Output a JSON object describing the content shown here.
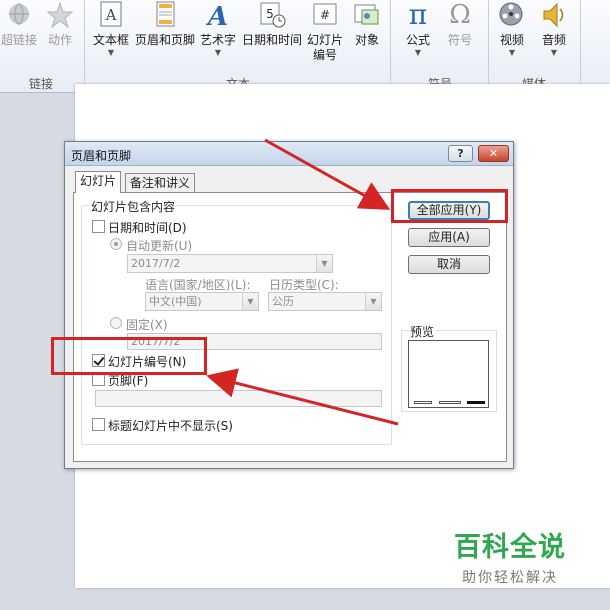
{
  "ribbon": {
    "groups": {
      "links": {
        "label": "链接",
        "buttons": [
          {
            "label": "超链接",
            "icon": "hyperlink-globe-icon",
            "enabled": false
          },
          {
            "label": "动作",
            "icon": "action-star-icon",
            "enabled": false
          }
        ]
      },
      "text": {
        "label": "文本",
        "buttons": [
          {
            "label": "文本框",
            "icon": "textbox-icon",
            "has_dropdown": true
          },
          {
            "label": "页眉和页脚",
            "icon": "header-footer-icon"
          },
          {
            "label": "艺术字",
            "icon": "wordart-icon",
            "has_dropdown": true
          },
          {
            "label": "日期和时间",
            "icon": "date-time-icon"
          },
          {
            "label_line1": "幻灯片",
            "label_line2": "编号",
            "icon": "slide-number-icon"
          },
          {
            "label": "对象",
            "icon": "object-icon"
          }
        ]
      },
      "symbols": {
        "label": "符号",
        "buttons": [
          {
            "label": "公式",
            "icon": "pi-equation-icon",
            "glyph": "π",
            "has_dropdown": true
          },
          {
            "label": "符号",
            "icon": "omega-symbol-icon",
            "glyph": "Ω",
            "enabled": false
          }
        ]
      },
      "media": {
        "label": "媒体",
        "buttons": [
          {
            "label": "视频",
            "icon": "video-reel-icon",
            "has_dropdown": true
          },
          {
            "label": "音频",
            "icon": "speaker-icon",
            "has_dropdown": true
          }
        ]
      }
    }
  },
  "dialog": {
    "title": "页眉和页脚",
    "help_glyph": "?",
    "close_glyph": "✕",
    "tabs": [
      {
        "label": "幻灯片",
        "active": true
      },
      {
        "label": "备注和讲义",
        "active": false
      }
    ],
    "group_title": "幻灯片包含内容",
    "date_time": {
      "label": "日期和时间(D)",
      "checked": false
    },
    "auto_update": {
      "label": "自动更新(U)",
      "selected": true,
      "value": "2017/7/2"
    },
    "language_label": "语言(国家/地区)(L):",
    "language_value": "中文(中国)",
    "calendar_label": "日历类型(C):",
    "calendar_value": "公历",
    "fixed": {
      "label": "固定(X)",
      "selected": false,
      "value": "2017/7/2"
    },
    "slide_number": {
      "label": "幻灯片编号(N)",
      "checked": true
    },
    "footer": {
      "label": "页脚(F)",
      "checked": false,
      "value": ""
    },
    "hide_on_title": {
      "label": "标题幻灯片中不显示(S)",
      "checked": false
    },
    "buttons": {
      "apply_all": "全部应用(Y)",
      "apply": "应用(A)",
      "cancel": "取消"
    },
    "preview_label": "预览"
  },
  "watermark": {
    "title": "百科全说",
    "subtitle": "助你轻松解决"
  },
  "colors": {
    "highlight": "#d42424",
    "watermark_green": "#2fa84f",
    "default_button_border": "#3c7fb1"
  }
}
